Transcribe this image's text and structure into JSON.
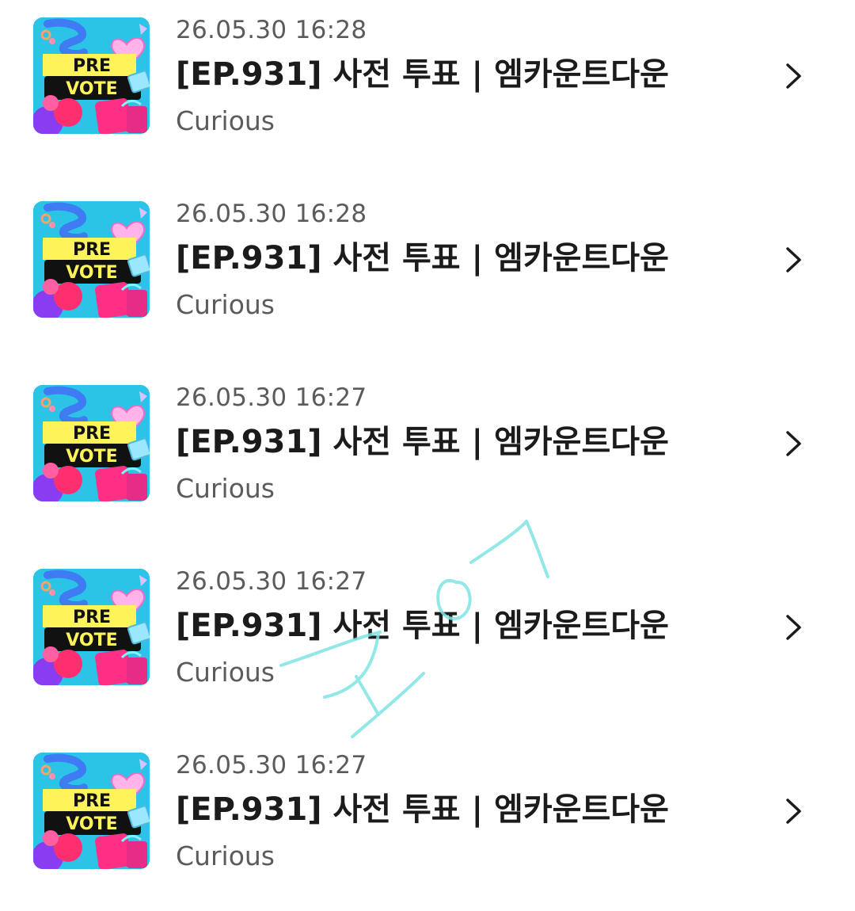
{
  "items": [
    {
      "date": "26.05.30 16:28",
      "title": "[EP.931] 사전 투표 | 엠카운트다운",
      "artist": "Curious",
      "art_line1": "PRE",
      "art_line2": "VOTE"
    },
    {
      "date": "26.05.30 16:28",
      "title": "[EP.931] 사전 투표 | 엠카운트다운",
      "artist": "Curious",
      "art_line1": "PRE",
      "art_line2": "VOTE"
    },
    {
      "date": "26.05.30 16:27",
      "title": "[EP.931] 사전 투표 | 엠카운트다운",
      "artist": "Curious",
      "art_line1": "PRE",
      "art_line2": "VOTE"
    },
    {
      "date": "26.05.30 16:27",
      "title": "[EP.931] 사전 투표 | 엠카운트다운",
      "artist": "Curious",
      "art_line1": "PRE",
      "art_line2": "VOTE"
    },
    {
      "date": "26.05.30 16:27",
      "title": "[EP.931] 사전 투표 | 엠카운트다운",
      "artist": "Curious",
      "art_line1": "PRE",
      "art_line2": "VOTE"
    }
  ],
  "icons": {
    "row_action": "chevron-right-icon"
  },
  "colors": {
    "art_background": "#2bc4e6",
    "art_banner": "#fff35a",
    "art_banner_dark": "#111111",
    "doodle": "#6fdde0"
  }
}
